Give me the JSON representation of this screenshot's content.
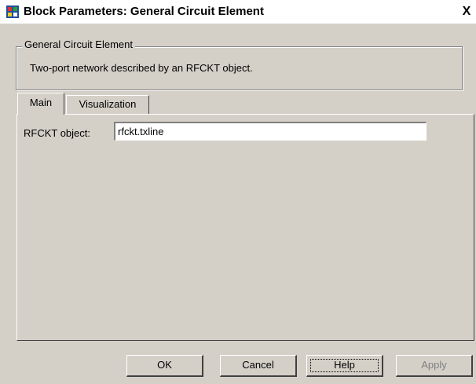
{
  "window": {
    "title": "Block Parameters: General  Circuit Element",
    "close_glyph": "X",
    "icon": "simulink-block-icon"
  },
  "group": {
    "legend": "General Circuit Element",
    "description": "Two-port network described by an RFCKT object."
  },
  "tabs": [
    {
      "label": "Main",
      "selected": true
    },
    {
      "label": "Visualization",
      "selected": false
    }
  ],
  "main": {
    "rfckt_label": "RFCKT object:",
    "rfckt_value": "rfckt.txline"
  },
  "buttons": {
    "ok": "OK",
    "cancel": "Cancel",
    "help": "Help",
    "apply": "Apply"
  },
  "colors": {
    "dialog_bg": "#d4d0c8",
    "disabled_text": "#808080"
  }
}
